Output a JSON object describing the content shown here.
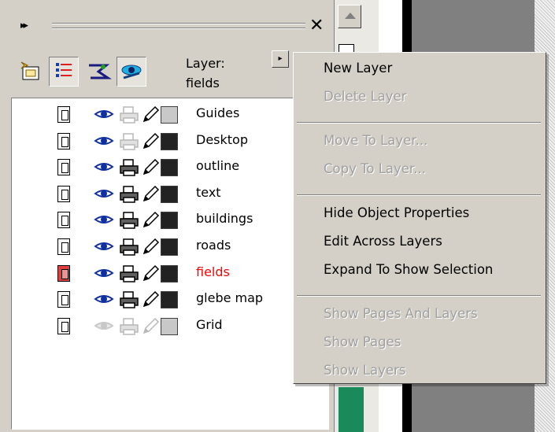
{
  "docker": {
    "grip_glyph": "▸▸",
    "close_glyph": "✕",
    "layer_label": "Layer:",
    "current_layer": "fields",
    "flyout_glyph": "▸",
    "toolbar_icons": [
      "new-layer-icon",
      "layer-manager-view-icon",
      "layer-manager-view-2-icon",
      "edit-across-layers-icon"
    ],
    "layers": [
      {
        "name": "Guides",
        "visible": true,
        "printable": false,
        "swatch": "#c8c8c8",
        "active": false,
        "dim": false
      },
      {
        "name": "Desktop",
        "visible": true,
        "printable": false,
        "swatch": "#222222",
        "active": false,
        "dim": false
      },
      {
        "name": "outline",
        "visible": true,
        "printable": true,
        "swatch": "#222222",
        "active": false,
        "dim": false
      },
      {
        "name": "text",
        "visible": true,
        "printable": true,
        "swatch": "#222222",
        "active": false,
        "dim": false
      },
      {
        "name": "buildings",
        "visible": true,
        "printable": true,
        "swatch": "#222222",
        "active": false,
        "dim": false
      },
      {
        "name": "roads",
        "visible": true,
        "printable": true,
        "swatch": "#222222",
        "active": false,
        "dim": false
      },
      {
        "name": "fields",
        "visible": true,
        "printable": true,
        "swatch": "#222222",
        "active": true,
        "dim": false
      },
      {
        "name": "glebe map",
        "visible": true,
        "printable": true,
        "swatch": "#222222",
        "active": false,
        "dim": false
      },
      {
        "name": "Grid",
        "visible": false,
        "printable": false,
        "swatch": "#c8c8c8",
        "active": false,
        "dim": true
      }
    ]
  },
  "context_menu": {
    "groups": [
      [
        {
          "label": "New Layer",
          "enabled": true
        },
        {
          "label": "Delete Layer",
          "enabled": false
        }
      ],
      [
        {
          "label": "Move To Layer...",
          "enabled": false
        },
        {
          "label": "Copy To Layer...",
          "enabled": false
        }
      ],
      [
        {
          "label": "Hide Object Properties",
          "enabled": true
        },
        {
          "label": "Edit Across Layers",
          "enabled": true
        },
        {
          "label": "Expand To Show Selection",
          "enabled": true
        }
      ],
      [
        {
          "label": "Show Pages And Layers",
          "enabled": false
        },
        {
          "label": "Show Pages",
          "enabled": false
        },
        {
          "label": "Show Layers",
          "enabled": false
        }
      ]
    ]
  },
  "colors": {
    "active_layer_text": "#ff0000",
    "palette": [
      "#3a0a78",
      "#1495e0",
      "#1a8a5a"
    ]
  }
}
